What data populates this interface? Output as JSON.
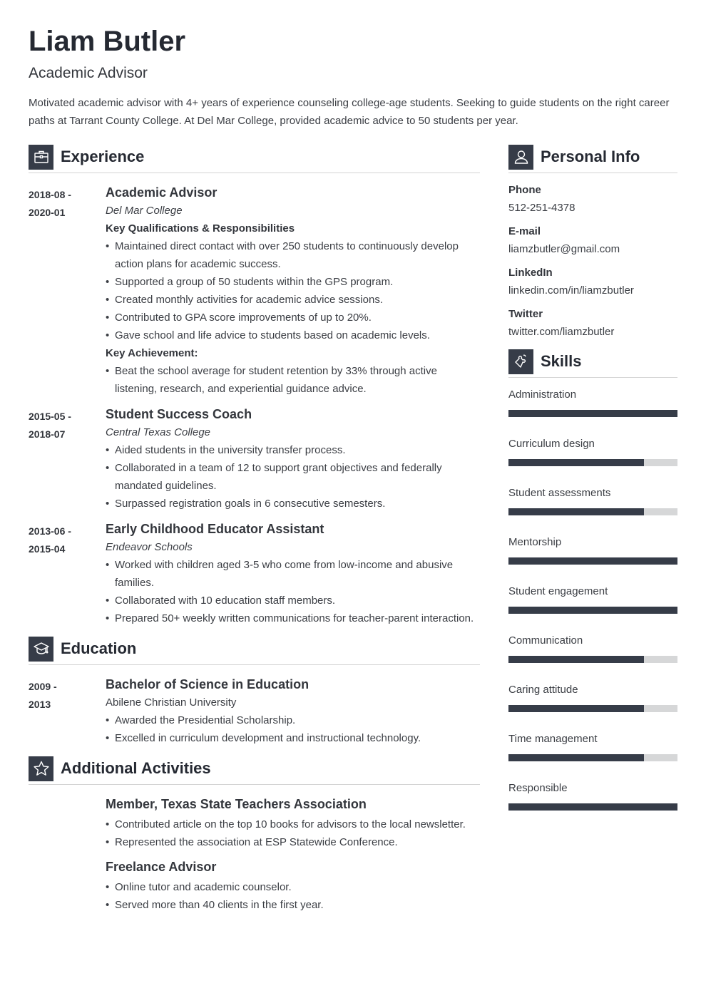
{
  "header": {
    "name": "Liam Butler",
    "title": "Academic Advisor",
    "summary": "Motivated academic advisor with 4+ years of experience counseling college-age students. Seeking to guide students on the right career paths at Tarrant County College. At Del Mar College, provided academic advice to 50 students per year."
  },
  "experience": {
    "heading": "Experience",
    "icon": "briefcase-icon",
    "items": [
      {
        "date_start": "2018-08 -",
        "date_end": "2020-01",
        "title": "Academic Advisor",
        "org": "Del Mar College",
        "sub1": "Key Qualifications & Responsibilities",
        "bullets1": [
          "Maintained direct contact with over 250 students to continuously develop action plans for academic success.",
          "Supported a group of 50 students within the GPS program.",
          "Created monthly activities for academic advice sessions.",
          "Contributed to GPA score improvements of up to 20%.",
          "Gave school and life advice to students based on academic levels."
        ],
        "sub2": "Key Achievement:",
        "bullets2": [
          "Beat the school average for student retention by 33% through active listening, research, and experiential guidance advice."
        ]
      },
      {
        "date_start": "2015-05 -",
        "date_end": "2018-07",
        "title": "Student Success Coach",
        "org": "Central Texas College",
        "bullets": [
          "Aided students in the university transfer process.",
          "Collaborated in a team of 12 to support grant objectives and federally mandated guidelines.",
          "Surpassed registration goals in 6 consecutive semesters."
        ]
      },
      {
        "date_start": "2013-06 -",
        "date_end": "2015-04",
        "title": "Early Childhood Educator Assistant",
        "org": "Endeavor Schools",
        "bullets": [
          "Worked with children aged 3-5 who come from low-income and abusive families.",
          "Collaborated with 10 education staff members.",
          "Prepared 50+ weekly written communications for teacher-parent interaction."
        ]
      }
    ]
  },
  "education": {
    "heading": "Education",
    "icon": "graduation-cap-icon",
    "items": [
      {
        "date_start": "2009 -",
        "date_end": "2013",
        "title": "Bachelor of Science in Education",
        "org": "Abilene Christian University",
        "bullets": [
          "Awarded the Presidential Scholarship.",
          "Excelled in curriculum development and instructional technology."
        ]
      }
    ]
  },
  "activities": {
    "heading": "Additional Activities",
    "icon": "star-icon",
    "items": [
      {
        "title": "Member, Texas State Teachers Association",
        "bullets": [
          "Contributed article on the top 10 books for advisors to the local newsletter.",
          "Represented the association at ESP Statewide Conference."
        ]
      },
      {
        "title": "Freelance Advisor",
        "bullets": [
          "Online tutor and academic counselor.",
          "Served more than 40 clients in the first year."
        ]
      }
    ]
  },
  "personal_info": {
    "heading": "Personal Info",
    "icon": "user-icon",
    "fields": [
      {
        "label": "Phone",
        "value": "512-251-4378"
      },
      {
        "label": "E-mail",
        "value": "liamzbutler@gmail.com"
      },
      {
        "label": "LinkedIn",
        "value": "linkedin.com/in/liamzbutler"
      },
      {
        "label": "Twitter",
        "value": "twitter.com/liamzbutler"
      }
    ]
  },
  "skills": {
    "heading": "Skills",
    "icon": "puzzle-icon",
    "items": [
      {
        "name": "Administration",
        "level": 1.0
      },
      {
        "name": "Curriculum design",
        "level": 0.8
      },
      {
        "name": "Student assessments",
        "level": 0.8
      },
      {
        "name": "Mentorship",
        "level": 1.0
      },
      {
        "name": "Student engagement",
        "level": 1.0
      },
      {
        "name": "Communication",
        "level": 0.8
      },
      {
        "name": "Caring attitude",
        "level": 0.8
      },
      {
        "name": "Time management",
        "level": 0.8
      },
      {
        "name": "Responsible",
        "level": 1.0
      }
    ]
  },
  "colors": {
    "accent": "#363c48",
    "bar_track": "#d6d7d8",
    "rule": "#d4d4d4"
  }
}
